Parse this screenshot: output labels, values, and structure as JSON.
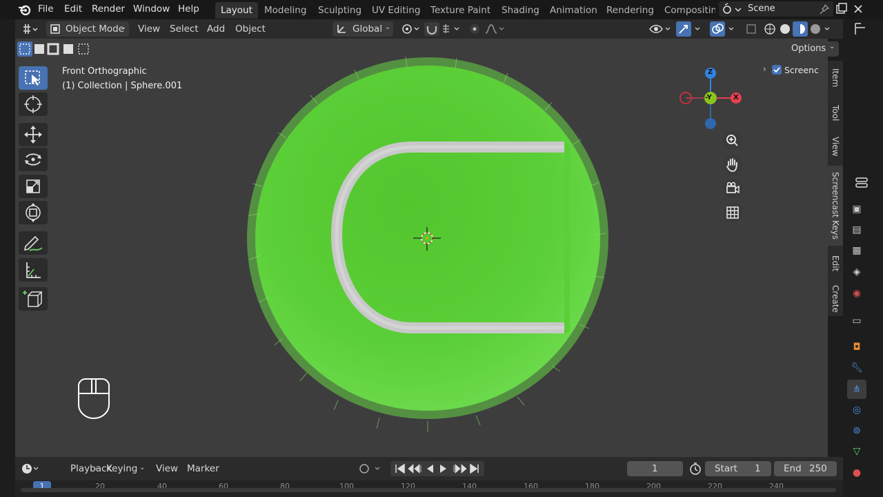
{
  "menubar": {
    "file": "File",
    "edit": "Edit",
    "render": "Render",
    "window": "Window",
    "help": "Help"
  },
  "workspaces": [
    {
      "label": "Layout",
      "active": true
    },
    {
      "label": "Modeling"
    },
    {
      "label": "Sculpting"
    },
    {
      "label": "UV Editing"
    },
    {
      "label": "Texture Paint"
    },
    {
      "label": "Shading"
    },
    {
      "label": "Animation"
    },
    {
      "label": "Rendering"
    },
    {
      "label": "Compositin"
    }
  ],
  "scene": {
    "name": "Scene"
  },
  "header": {
    "mode": "Object Mode",
    "view": "View",
    "select": "Select",
    "add": "Add",
    "object": "Object",
    "orientation": "Global"
  },
  "options_label": "Options",
  "viewport": {
    "view_name": "Front Orthographic",
    "collection_info": "(1) Collection | Sphere.001",
    "screencast_label": "Screenc"
  },
  "gizmo": {
    "z": "Z",
    "y": "-Y",
    "x": "X"
  },
  "sidebar_tabs": [
    "Item",
    "Tool",
    "View",
    "Screencast Keys",
    "Edit",
    "Create"
  ],
  "timeline": {
    "playback": "Playback",
    "keying": "Keying",
    "view": "View",
    "marker": "Marker",
    "current_frame": "1",
    "start_label": "Start",
    "start_value": "1",
    "end_label": "End",
    "end_value": "250"
  },
  "ruler": {
    "current": "1",
    "ticks": [
      "20",
      "40",
      "60",
      "80",
      "100",
      "120",
      "140",
      "160",
      "180",
      "200",
      "220",
      "240"
    ]
  },
  "colors": {
    "accent": "#4772b3",
    "ball_green": "#5fcc3a",
    "seam": "#c8c8c8",
    "axis_x": "#e6404f",
    "axis_y": "#8ac51c",
    "axis_z": "#2f84e3"
  }
}
